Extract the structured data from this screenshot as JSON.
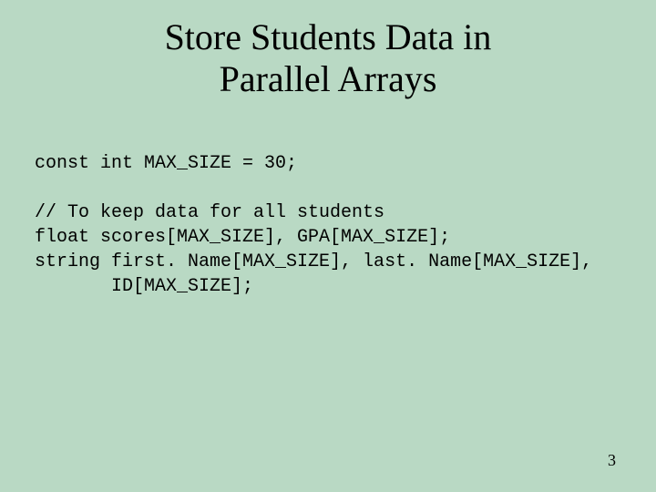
{
  "title_line1": "Store Students Data in",
  "title_line2": "Parallel Arrays",
  "code_line1": "const int MAX_SIZE = 30;",
  "code_line2": "",
  "code_line3": "// To keep data for all students",
  "code_line4": "float scores[MAX_SIZE], GPA[MAX_SIZE];",
  "code_line5": "string first. Name[MAX_SIZE], last. Name[MAX_SIZE],",
  "code_line6": "       ID[MAX_SIZE];",
  "page_number": "3"
}
